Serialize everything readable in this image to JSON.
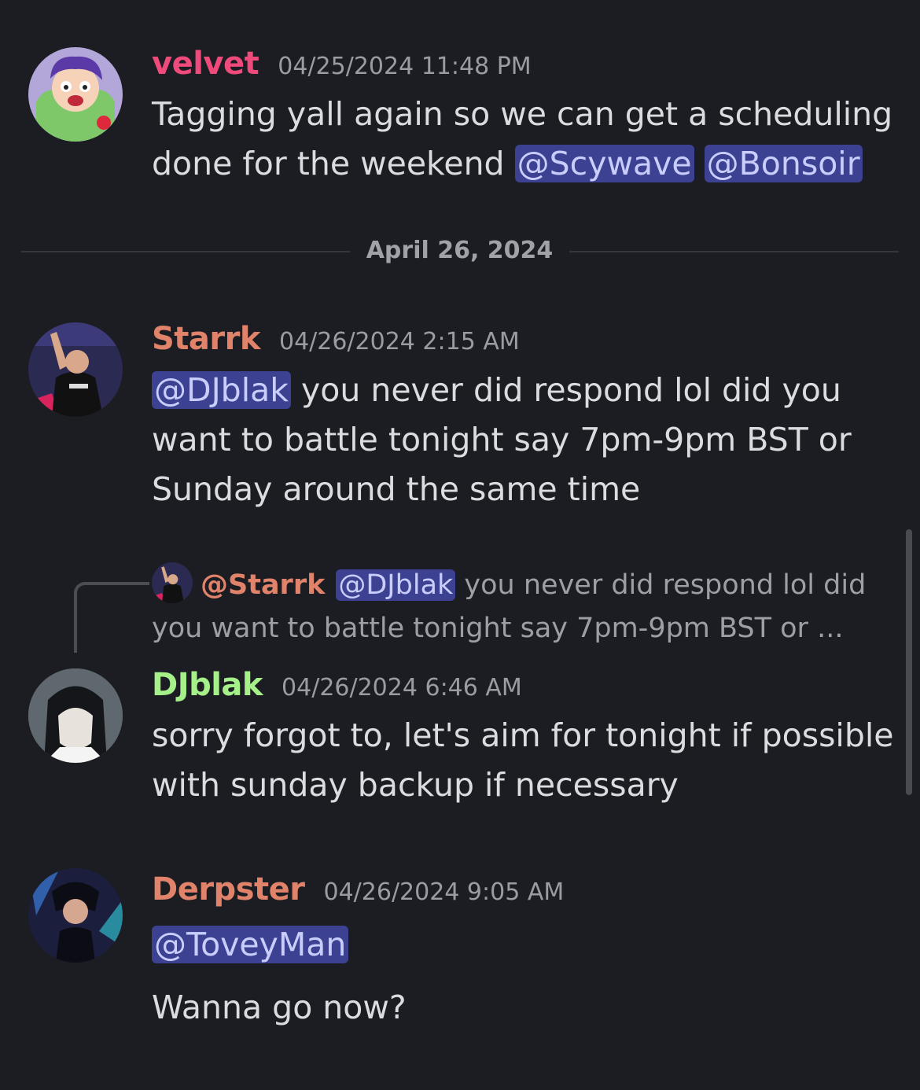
{
  "messages": [
    {
      "username": "velvet",
      "username_color": "#ee4a7b",
      "timestamp": "04/25/2024 11:48 PM",
      "text_parts": [
        "Tagging yall again so we can get a scheduling done for the weekend "
      ],
      "mentions": [
        "@Scywave",
        "@Bonsoir"
      ]
    },
    {
      "username": "Starrk",
      "username_color": "#e0836a",
      "timestamp": "04/26/2024 2:15 AM",
      "mention": "@DJblak",
      "text": " you never did respond lol did you want to battle tonight say 7pm-9pm BST or Sunday around the same time"
    },
    {
      "reply": {
        "user": "@Starrk",
        "mention": "@DJblak",
        "text": " you never did respond lol did you want to battle tonight say 7pm-9pm BST or ..."
      },
      "username": "DJblak",
      "username_color": "#a6f08a",
      "timestamp": "04/26/2024 6:46 AM",
      "text": "sorry forgot to, let's aim for tonight if possible with sunday backup if necessary"
    },
    {
      "username": "Derpster",
      "username_color": "#e0836a",
      "timestamp": "04/26/2024 9:05 AM",
      "mention": "@ToveyMan",
      "text": "Wanna go now?"
    }
  ],
  "date_divider": "April 26, 2024"
}
